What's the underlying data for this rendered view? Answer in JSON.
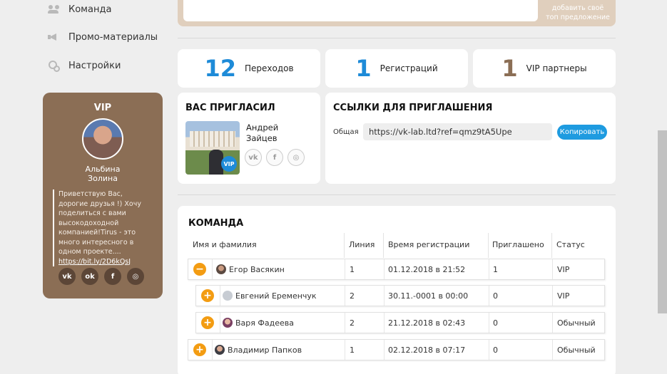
{
  "sidebar": {
    "items": [
      {
        "label": "Команда",
        "icon": "team-icon"
      },
      {
        "label": "Промо-материалы",
        "icon": "megaphone-icon"
      },
      {
        "label": "Настройки",
        "icon": "settings-icon"
      }
    ],
    "vip_card": {
      "title": "VIP",
      "name_line1": "Альбина",
      "name_line2": "Золина",
      "message": "Приветствую Вас, дорогие друзья !) Хочу поделиться с вами высокодоходной компанией!Tirus - это много интересного в одном проекте....",
      "link": "https://bit.ly/2D6kQsJ",
      "socials": [
        "vk-icon",
        "odnoklassniki-icon",
        "facebook-icon",
        "instagram-icon"
      ],
      "color": "#8b6e55"
    }
  },
  "offer": {
    "line1": "добавить своё",
    "line2": "топ предложение"
  },
  "stats": [
    {
      "value": "12",
      "label": "Переходов",
      "color": "#1e8bd8"
    },
    {
      "value": "1",
      "label": "Регистраций",
      "color": "#1e8bd8"
    },
    {
      "value": "1",
      "label": "VIP партнеры",
      "color": "#8b6e55"
    }
  ],
  "inviter": {
    "title": "ВАС ПРИГЛАСИЛ",
    "name_line1": "Андрей",
    "name_line2": "Зайцев",
    "badge": "VIP",
    "socials": [
      "vk-icon",
      "facebook-icon",
      "instagram-icon"
    ]
  },
  "links": {
    "title": "ССЫЛКИ ДЛЯ ПРИГЛАШЕНИЯ",
    "label": "Общая",
    "url": "https://vk-lab.ltd?ref=qmz9tA5Upe",
    "copy_label": "Копировать",
    "accent": "#1e9be0"
  },
  "team": {
    "title": "КОМАНДА",
    "columns": [
      "Имя и фамилия",
      "Линия",
      "Время регистрации",
      "Приглашено",
      "Статус"
    ],
    "rows": [
      {
        "name": "Егор Васякин",
        "line": "1",
        "time": "01.12.2018 в 21:52",
        "invited": "1",
        "status": "VIP",
        "toggle": "−",
        "indent": 0
      },
      {
        "name": "Евгений Еременчук",
        "line": "2",
        "time": "30.11.-0001 в 00:00",
        "invited": "0",
        "status": "VIP",
        "toggle": "+",
        "indent": 1
      },
      {
        "name": "Варя Фадеева",
        "line": "2",
        "time": "21.12.2018 в 02:43",
        "invited": "0",
        "status": "Обычный",
        "toggle": "+",
        "indent": 1
      },
      {
        "name": "Владимир Папков",
        "line": "1",
        "time": "02.12.2018 в 07:17",
        "invited": "0",
        "status": "Обычный",
        "toggle": "+",
        "indent": 0
      }
    ],
    "toggle_color": "#f39c12"
  }
}
